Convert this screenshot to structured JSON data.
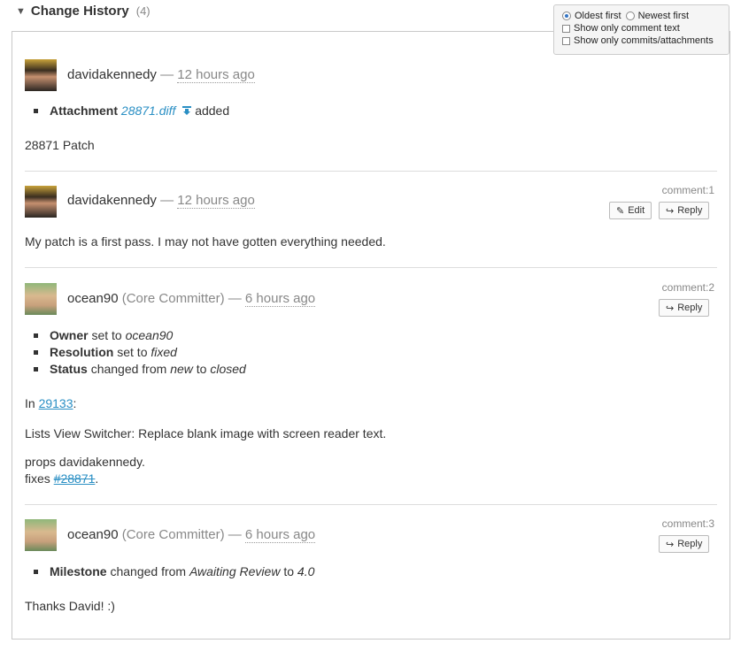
{
  "header": {
    "title": "Change History",
    "count": "(4)"
  },
  "prefs": {
    "oldest_first": "Oldest first",
    "newest_first": "Newest first",
    "comment_only": "Show only comment text",
    "commits_only": "Show only commits/attachments"
  },
  "entries": [
    {
      "author": "davidakennedy",
      "dash": "—",
      "time": "12 hours ago",
      "attachment_label": "Attachment",
      "attachment_file": "28871.diff",
      "attachment_verb": "added",
      "body": "28871 Patch"
    },
    {
      "author": "davidakennedy",
      "dash": "—",
      "time": "12 hours ago",
      "comment_num": "comment:1",
      "edit_label": "Edit",
      "reply_label": "Reply",
      "body": "My patch is a first pass. I may not have gotten everything needed."
    },
    {
      "author": "ocean90",
      "role": "(Core Committer)",
      "dash": "—",
      "time": "6 hours ago",
      "comment_num": "comment:2",
      "reply_label": "Reply",
      "changes": {
        "owner_field": "Owner",
        "owner_mid": "set to",
        "owner_val": "ocean90",
        "res_field": "Resolution",
        "res_mid": "set to",
        "res_val": "fixed",
        "status_field": "Status",
        "status_mid": "changed from",
        "status_from": "new",
        "status_to_word": "to",
        "status_to": "closed"
      },
      "in_prefix": "In",
      "changeset": "29133",
      "in_suffix": ":",
      "line1": "Lists View Switcher: Replace blank image with screen reader text.",
      "line2": "props davidakennedy.",
      "fixes_prefix": "fixes",
      "ticket": "#28871",
      "fixes_suffix": "."
    },
    {
      "author": "ocean90",
      "role": "(Core Committer)",
      "dash": "—",
      "time": "6 hours ago",
      "comment_num": "comment:3",
      "reply_label": "Reply",
      "changes": {
        "ms_field": "Milestone",
        "ms_mid": "changed from",
        "ms_from": "Awaiting Review",
        "ms_to_word": "to",
        "ms_to": "4.0"
      },
      "body": "Thanks David! :)"
    }
  ]
}
